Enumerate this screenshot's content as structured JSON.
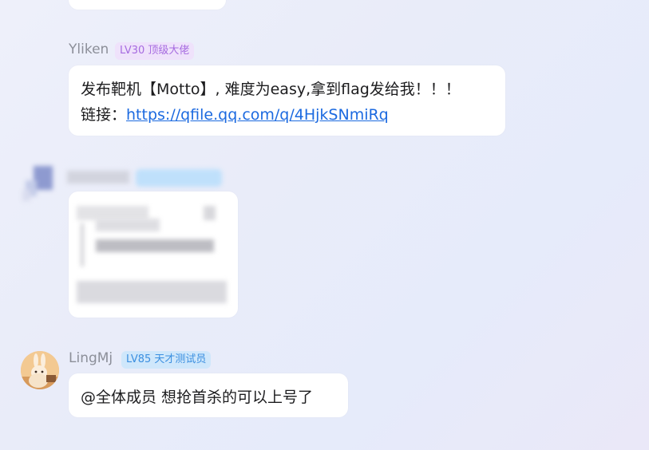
{
  "messages": [
    {
      "sender": "Yliken",
      "badge": "LV30 顶级大佬",
      "badge_color": "#a66be0",
      "line1": "发布靶机【Motto】, 难度为easy,拿到flag发给我！！！",
      "line2_prefix": "链接：",
      "link": "https://qfile.qq.com/q/4HjkSNmiRq"
    },
    {
      "sender": "LingMj",
      "badge": "LV85 天才测试员",
      "badge_color": "#3b8fe0",
      "text": "@全体成员 想抢首杀的可以上号了",
      "avatar_icon": "rabbit-avatar-icon"
    }
  ]
}
